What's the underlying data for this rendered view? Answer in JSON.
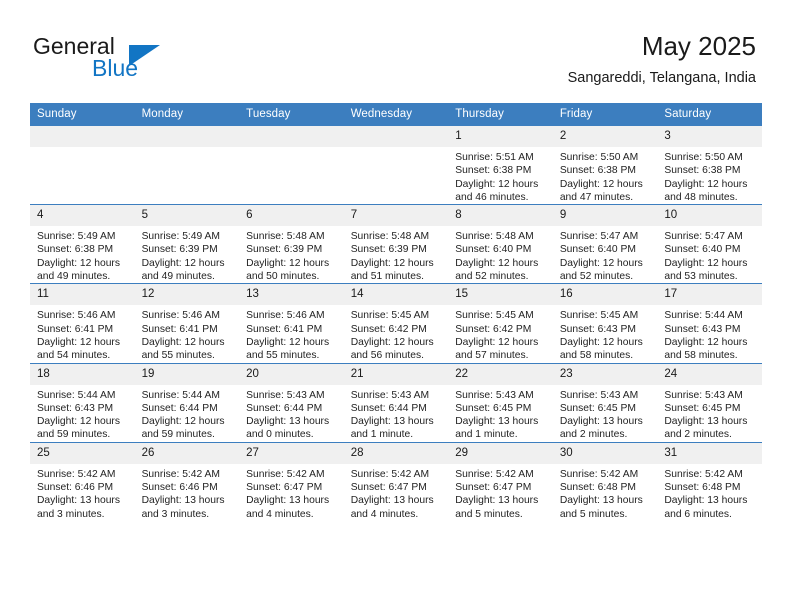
{
  "logo": {
    "word1": "General",
    "word2": "Blue",
    "triangle_color": "#1275c4",
    "icon": "triangle-icon"
  },
  "header": {
    "title": "May 2025",
    "subtitle": "Sangareddi, Telangana, India"
  },
  "theme": {
    "header_bg": "#3c7ebf",
    "header_text": "#ffffff",
    "daynum_bg": "#f0f0f0",
    "body_text": "#232323"
  },
  "weekday_headers": [
    "Sunday",
    "Monday",
    "Tuesday",
    "Wednesday",
    "Thursday",
    "Friday",
    "Saturday"
  ],
  "weeks": [
    [
      {
        "day": "",
        "sunrise": "",
        "sunset": "",
        "daylight": "",
        "blank": true
      },
      {
        "day": "",
        "sunrise": "",
        "sunset": "",
        "daylight": "",
        "blank": true
      },
      {
        "day": "",
        "sunrise": "",
        "sunset": "",
        "daylight": "",
        "blank": true
      },
      {
        "day": "",
        "sunrise": "",
        "sunset": "",
        "daylight": "",
        "blank": true
      },
      {
        "day": "1",
        "sunrise": "Sunrise: 5:51 AM",
        "sunset": "Sunset: 6:38 PM",
        "daylight": "Daylight: 12 hours and 46 minutes."
      },
      {
        "day": "2",
        "sunrise": "Sunrise: 5:50 AM",
        "sunset": "Sunset: 6:38 PM",
        "daylight": "Daylight: 12 hours and 47 minutes."
      },
      {
        "day": "3",
        "sunrise": "Sunrise: 5:50 AM",
        "sunset": "Sunset: 6:38 PM",
        "daylight": "Daylight: 12 hours and 48 minutes."
      }
    ],
    [
      {
        "day": "4",
        "sunrise": "Sunrise: 5:49 AM",
        "sunset": "Sunset: 6:38 PM",
        "daylight": "Daylight: 12 hours and 49 minutes."
      },
      {
        "day": "5",
        "sunrise": "Sunrise: 5:49 AM",
        "sunset": "Sunset: 6:39 PM",
        "daylight": "Daylight: 12 hours and 49 minutes."
      },
      {
        "day": "6",
        "sunrise": "Sunrise: 5:48 AM",
        "sunset": "Sunset: 6:39 PM",
        "daylight": "Daylight: 12 hours and 50 minutes."
      },
      {
        "day": "7",
        "sunrise": "Sunrise: 5:48 AM",
        "sunset": "Sunset: 6:39 PM",
        "daylight": "Daylight: 12 hours and 51 minutes."
      },
      {
        "day": "8",
        "sunrise": "Sunrise: 5:48 AM",
        "sunset": "Sunset: 6:40 PM",
        "daylight": "Daylight: 12 hours and 52 minutes."
      },
      {
        "day": "9",
        "sunrise": "Sunrise: 5:47 AM",
        "sunset": "Sunset: 6:40 PM",
        "daylight": "Daylight: 12 hours and 52 minutes."
      },
      {
        "day": "10",
        "sunrise": "Sunrise: 5:47 AM",
        "sunset": "Sunset: 6:40 PM",
        "daylight": "Daylight: 12 hours and 53 minutes."
      }
    ],
    [
      {
        "day": "11",
        "sunrise": "Sunrise: 5:46 AM",
        "sunset": "Sunset: 6:41 PM",
        "daylight": "Daylight: 12 hours and 54 minutes."
      },
      {
        "day": "12",
        "sunrise": "Sunrise: 5:46 AM",
        "sunset": "Sunset: 6:41 PM",
        "daylight": "Daylight: 12 hours and 55 minutes."
      },
      {
        "day": "13",
        "sunrise": "Sunrise: 5:46 AM",
        "sunset": "Sunset: 6:41 PM",
        "daylight": "Daylight: 12 hours and 55 minutes."
      },
      {
        "day": "14",
        "sunrise": "Sunrise: 5:45 AM",
        "sunset": "Sunset: 6:42 PM",
        "daylight": "Daylight: 12 hours and 56 minutes."
      },
      {
        "day": "15",
        "sunrise": "Sunrise: 5:45 AM",
        "sunset": "Sunset: 6:42 PM",
        "daylight": "Daylight: 12 hours and 57 minutes."
      },
      {
        "day": "16",
        "sunrise": "Sunrise: 5:45 AM",
        "sunset": "Sunset: 6:43 PM",
        "daylight": "Daylight: 12 hours and 58 minutes."
      },
      {
        "day": "17",
        "sunrise": "Sunrise: 5:44 AM",
        "sunset": "Sunset: 6:43 PM",
        "daylight": "Daylight: 12 hours and 58 minutes."
      }
    ],
    [
      {
        "day": "18",
        "sunrise": "Sunrise: 5:44 AM",
        "sunset": "Sunset: 6:43 PM",
        "daylight": "Daylight: 12 hours and 59 minutes."
      },
      {
        "day": "19",
        "sunrise": "Sunrise: 5:44 AM",
        "sunset": "Sunset: 6:44 PM",
        "daylight": "Daylight: 12 hours and 59 minutes."
      },
      {
        "day": "20",
        "sunrise": "Sunrise: 5:43 AM",
        "sunset": "Sunset: 6:44 PM",
        "daylight": "Daylight: 13 hours and 0 minutes."
      },
      {
        "day": "21",
        "sunrise": "Sunrise: 5:43 AM",
        "sunset": "Sunset: 6:44 PM",
        "daylight": "Daylight: 13 hours and 1 minute."
      },
      {
        "day": "22",
        "sunrise": "Sunrise: 5:43 AM",
        "sunset": "Sunset: 6:45 PM",
        "daylight": "Daylight: 13 hours and 1 minute."
      },
      {
        "day": "23",
        "sunrise": "Sunrise: 5:43 AM",
        "sunset": "Sunset: 6:45 PM",
        "daylight": "Daylight: 13 hours and 2 minutes."
      },
      {
        "day": "24",
        "sunrise": "Sunrise: 5:43 AM",
        "sunset": "Sunset: 6:45 PM",
        "daylight": "Daylight: 13 hours and 2 minutes."
      }
    ],
    [
      {
        "day": "25",
        "sunrise": "Sunrise: 5:42 AM",
        "sunset": "Sunset: 6:46 PM",
        "daylight": "Daylight: 13 hours and 3 minutes."
      },
      {
        "day": "26",
        "sunrise": "Sunrise: 5:42 AM",
        "sunset": "Sunset: 6:46 PM",
        "daylight": "Daylight: 13 hours and 3 minutes."
      },
      {
        "day": "27",
        "sunrise": "Sunrise: 5:42 AM",
        "sunset": "Sunset: 6:47 PM",
        "daylight": "Daylight: 13 hours and 4 minutes."
      },
      {
        "day": "28",
        "sunrise": "Sunrise: 5:42 AM",
        "sunset": "Sunset: 6:47 PM",
        "daylight": "Daylight: 13 hours and 4 minutes."
      },
      {
        "day": "29",
        "sunrise": "Sunrise: 5:42 AM",
        "sunset": "Sunset: 6:47 PM",
        "daylight": "Daylight: 13 hours and 5 minutes."
      },
      {
        "day": "30",
        "sunrise": "Sunrise: 5:42 AM",
        "sunset": "Sunset: 6:48 PM",
        "daylight": "Daylight: 13 hours and 5 minutes."
      },
      {
        "day": "31",
        "sunrise": "Sunrise: 5:42 AM",
        "sunset": "Sunset: 6:48 PM",
        "daylight": "Daylight: 13 hours and 6 minutes."
      }
    ]
  ]
}
